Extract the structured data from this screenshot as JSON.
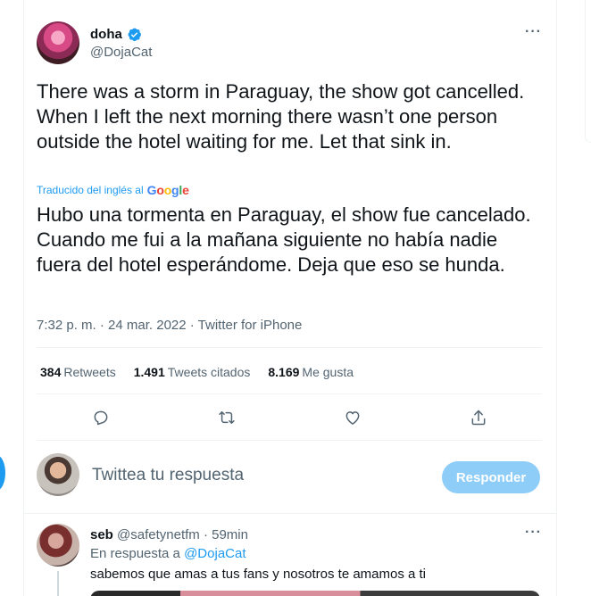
{
  "tweet": {
    "display_name": "doha",
    "handle": "@DojaCat",
    "text_original": "There was a storm in Paraguay, the show got cancelled. When I left the next morning there wasn’t one person outside the hotel waiting for me. Let that sink in.",
    "translated_from_label": "Traducido del inglés al",
    "translator_brand": [
      "G",
      "o",
      "o",
      "g",
      "l",
      "e"
    ],
    "text_translated": "Hubo una tormenta en Paraguay, el show fue cancelado. Cuando me fui a la mañana siguiente no había nadie fuera del hotel esperándome. Deja que eso se hunda.",
    "meta": "7:32 p. m. · 24 mar. 2022 · Twitter for iPhone"
  },
  "stats": {
    "retweets_count": "384",
    "retweets_label": "Retweets",
    "quotes_count": "1.491",
    "quotes_label": "Tweets citados",
    "likes_count": "8.169",
    "likes_label": "Me gusta"
  },
  "compose": {
    "placeholder": "Twittea tu respuesta",
    "button_label": "Responder"
  },
  "reply": {
    "display_name": "seb",
    "meta": "@safetynetfm · 59min",
    "in_reply_prefix": "En respuesta a",
    "in_reply_handle": "@DojaCat",
    "text": "sabemos que amas a tus fans y nosotros te amamos a ti"
  },
  "icons": {
    "verified": "verified-badge-icon",
    "more": "more-icon",
    "reply": "reply-icon",
    "retweet": "retweet-icon",
    "like": "heart-icon",
    "share": "share-icon"
  },
  "colors": {
    "accent": "#1d9bf0",
    "muted_text": "#536471",
    "button_disabled": "#8ecdf8"
  }
}
